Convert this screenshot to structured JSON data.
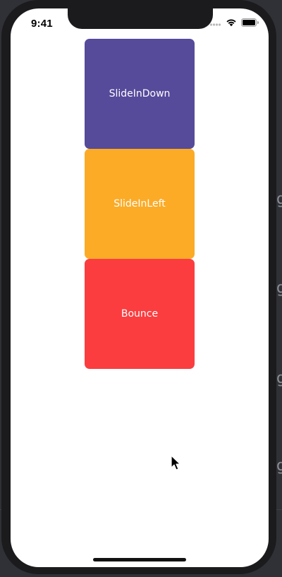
{
  "status_bar": {
    "time": "9:41",
    "icons": [
      "signal-dots-icon",
      "wifi-icon",
      "battery-icon"
    ]
  },
  "cards": [
    {
      "label": "SlideInDown",
      "color": "#564a9b"
    },
    {
      "label": "SlideInLeft",
      "color": "#fcab26"
    },
    {
      "label": "Bounce",
      "color": "#fb3d3f"
    }
  ],
  "backdrop": {
    "color": "#2f3136"
  }
}
